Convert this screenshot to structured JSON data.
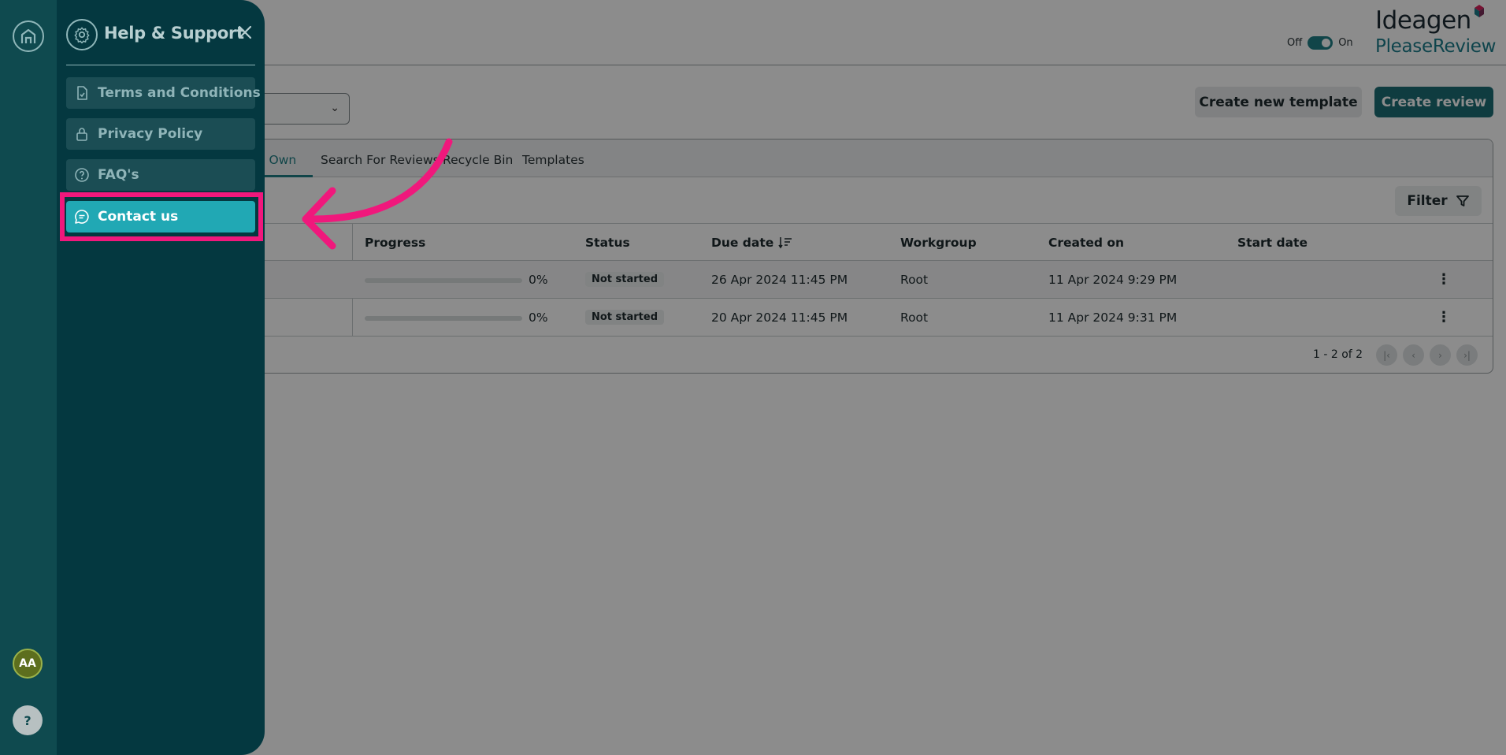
{
  "header": {
    "toggle_off": "Off",
    "toggle_on": "On",
    "logo_brand": "Ideagen",
    "logo_product": "PleaseReview"
  },
  "actions": {
    "create_template": "Create new template",
    "create_review": "Create review"
  },
  "tabs": [
    {
      "label": "s I Own",
      "active": true
    },
    {
      "label": "Search For Reviews",
      "active": false
    },
    {
      "label": "Recycle Bin",
      "active": false
    },
    {
      "label": "Templates",
      "active": false
    }
  ],
  "filter_label": "Filter",
  "table": {
    "columns": [
      "Progress",
      "Status",
      "Due date",
      "Workgroup",
      "Created on",
      "Start date"
    ],
    "rows": [
      {
        "progress": "0%",
        "status": "Not started",
        "due": "26 Apr 2024 11:45 PM",
        "workgroup": "Root",
        "created": "11 Apr 2024 9:29 PM",
        "start": ""
      },
      {
        "progress": "0%",
        "status": "Not started",
        "due": "20 Apr 2024 11:45 PM",
        "workgroup": "Root",
        "created": "11 Apr 2024 9:31 PM",
        "start": ""
      }
    ],
    "pagination": "1 - 2 of 2"
  },
  "rail": {
    "avatar_initials": "AA",
    "help_label": "?"
  },
  "drawer": {
    "title": "Help & Support",
    "items": [
      {
        "label": "Terms and Conditions",
        "icon": "document-icon",
        "active": false
      },
      {
        "label": "Privacy Policy",
        "icon": "lock-icon",
        "active": false
      },
      {
        "label": "FAQ's",
        "icon": "question-circle-icon",
        "active": false
      },
      {
        "label": "Contact us",
        "icon": "chat-icon",
        "active": true
      }
    ]
  },
  "colors": {
    "rail": "#0f4a4f",
    "drawer": "#043840",
    "active_item": "#21a8b4",
    "highlight": "#f0187c",
    "primary_button": "#1c6d75"
  }
}
